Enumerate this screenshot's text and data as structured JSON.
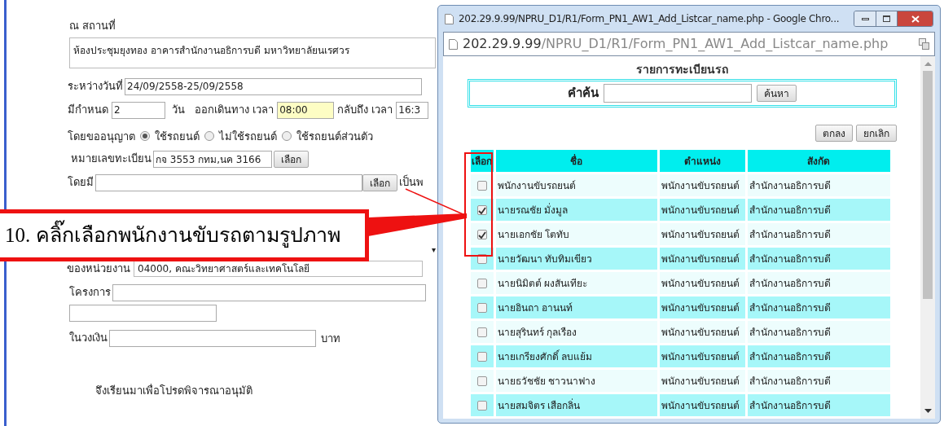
{
  "form": {
    "venue_label": "ณ สถานที่",
    "venue": "ห้องประชุมยุงทอง  อาคารสำนักงานอธิการบดี  มหาวิทยาลัยนเรศวร",
    "date_label": "ระหว่างวันที่",
    "date": "24/09/2558-25/09/2558",
    "duration_label": "มีกำหนด",
    "duration": "2",
    "days_label": "วัน",
    "depart_label": "ออกเดินทาง เวลา",
    "depart": "08:00",
    "return_label": "กลับถึง เวลา",
    "return": "16:3",
    "permit_label": "โดยขออนุญาต",
    "permit_options": [
      {
        "label": "ใช้รถยนต์",
        "selected": true
      },
      {
        "label": "ไม่ใช้รถยนต์",
        "selected": false
      },
      {
        "label": "ใช้รถยนต์ส่วนตัว",
        "selected": false
      }
    ],
    "plate_label": "หมายเลขทะเบียน",
    "plate": "กจ 3553 กทม,นค 3166",
    "plate_button": "เลือก",
    "driver_label": "โดยมี",
    "driver_button": "เลือก",
    "driver_suffix": "เป็นพ",
    "select_arrow": "▾",
    "unit_label": "ของหน่วยงาน",
    "unit": "04000, คณะวิทยาศาสตร์และเทคโนโลยี",
    "project_label": "โครงการ",
    "budget_label": "ในวงเงิน",
    "budget_unit": "บาท",
    "closing": "จึงเรียนมาเพื่อโปรดพิจารณาอนุมัติ"
  },
  "callout": "10. คลิ๊กเลือกพนักงานขับรถตามรูปภาพ",
  "popup": {
    "title": "202.29.9.99/NPRU_D1/R1/Form_PN1_AW1_Add_Listcar_name.php - Google Chro...",
    "address_host": "202.29.9.99",
    "address_path": "/NPRU_D1/R1/Form_PN1_AW1_Add_Listcar_name.php",
    "heading": "รายการทะเบียนรถ",
    "search_label": "คำค้น",
    "search_button": "ค้นหา",
    "ok_button": "ตกลง",
    "cancel_button": "ยกเลิก",
    "table": {
      "columns": [
        "เลือก",
        "ชื่อ",
        "ตำแหน่ง",
        "สังกัด"
      ],
      "rows": [
        {
          "checked": false,
          "name": "พนักงานขับรถยนต์",
          "position": "พนักงานขับรถยนต์",
          "unit": "สำนักงานอธิการบดี"
        },
        {
          "checked": true,
          "name": "นายรณชัย  มั่งมูล",
          "position": "พนักงานขับรถยนต์",
          "unit": "สำนักงานอธิการบดี"
        },
        {
          "checked": true,
          "name": "นายเอกชัย  โตทับ",
          "position": "พนักงานขับรถยนต์",
          "unit": "สำนักงานอธิการบดี"
        },
        {
          "checked": false,
          "name": "นายวัฒนา  ทับทิมเขียว",
          "position": "พนักงานขับรถยนต์",
          "unit": "สำนักงานอธิการบดี"
        },
        {
          "checked": false,
          "name": "นายนิมิตต์  ผงสันเทียะ",
          "position": "พนักงานขับรถยนต์",
          "unit": "สำนักงานอธิการบดี"
        },
        {
          "checked": false,
          "name": "นายอินถา  อานนท์",
          "position": "พนักงานขับรถยนต์",
          "unit": "สำนักงานอธิการบดี"
        },
        {
          "checked": false,
          "name": "นายสุรินทร์  กุลเรือง",
          "position": "พนักงานขับรถยนต์",
          "unit": "สำนักงานอธิการบดี"
        },
        {
          "checked": false,
          "name": "นายเกรียงศักดิ์  ลบแย้ม",
          "position": "พนักงานขับรถยนต์",
          "unit": "สำนักงานอธิการบดี"
        },
        {
          "checked": false,
          "name": "นายธวัชชัย  ชาวนาฟาง",
          "position": "พนักงานขับรถยนต์",
          "unit": "สำนักงานอธิการบดี"
        },
        {
          "checked": false,
          "name": "นายสมจิตร  เสือกลิ่น",
          "position": "พนักงานขับรถยนต์",
          "unit": "สำนักงานอธิการบดี"
        }
      ]
    }
  }
}
